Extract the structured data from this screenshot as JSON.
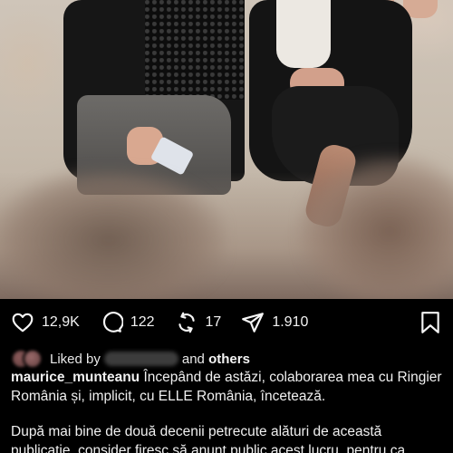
{
  "post": {
    "actions": {
      "likes": "12,9K",
      "comments": "122",
      "reposts": "17",
      "shares": "1.910",
      "icons": [
        "heart-icon",
        "comment-icon",
        "repost-icon",
        "share-icon",
        "bookmark-icon"
      ]
    },
    "liked_by": {
      "prefix": "Liked by",
      "middle": "and",
      "others": "others"
    },
    "caption": {
      "username": "maurice_munteanu",
      "text": "Începând de astăzi, colaborarea mea cu Ringier România și, implicit, cu ELLE România, încetează.",
      "second_paragraph": "După mai bine de două decenii petrecute alături de această publicație, consider firesc să anunț public acest lucru, pentru ca"
    }
  }
}
